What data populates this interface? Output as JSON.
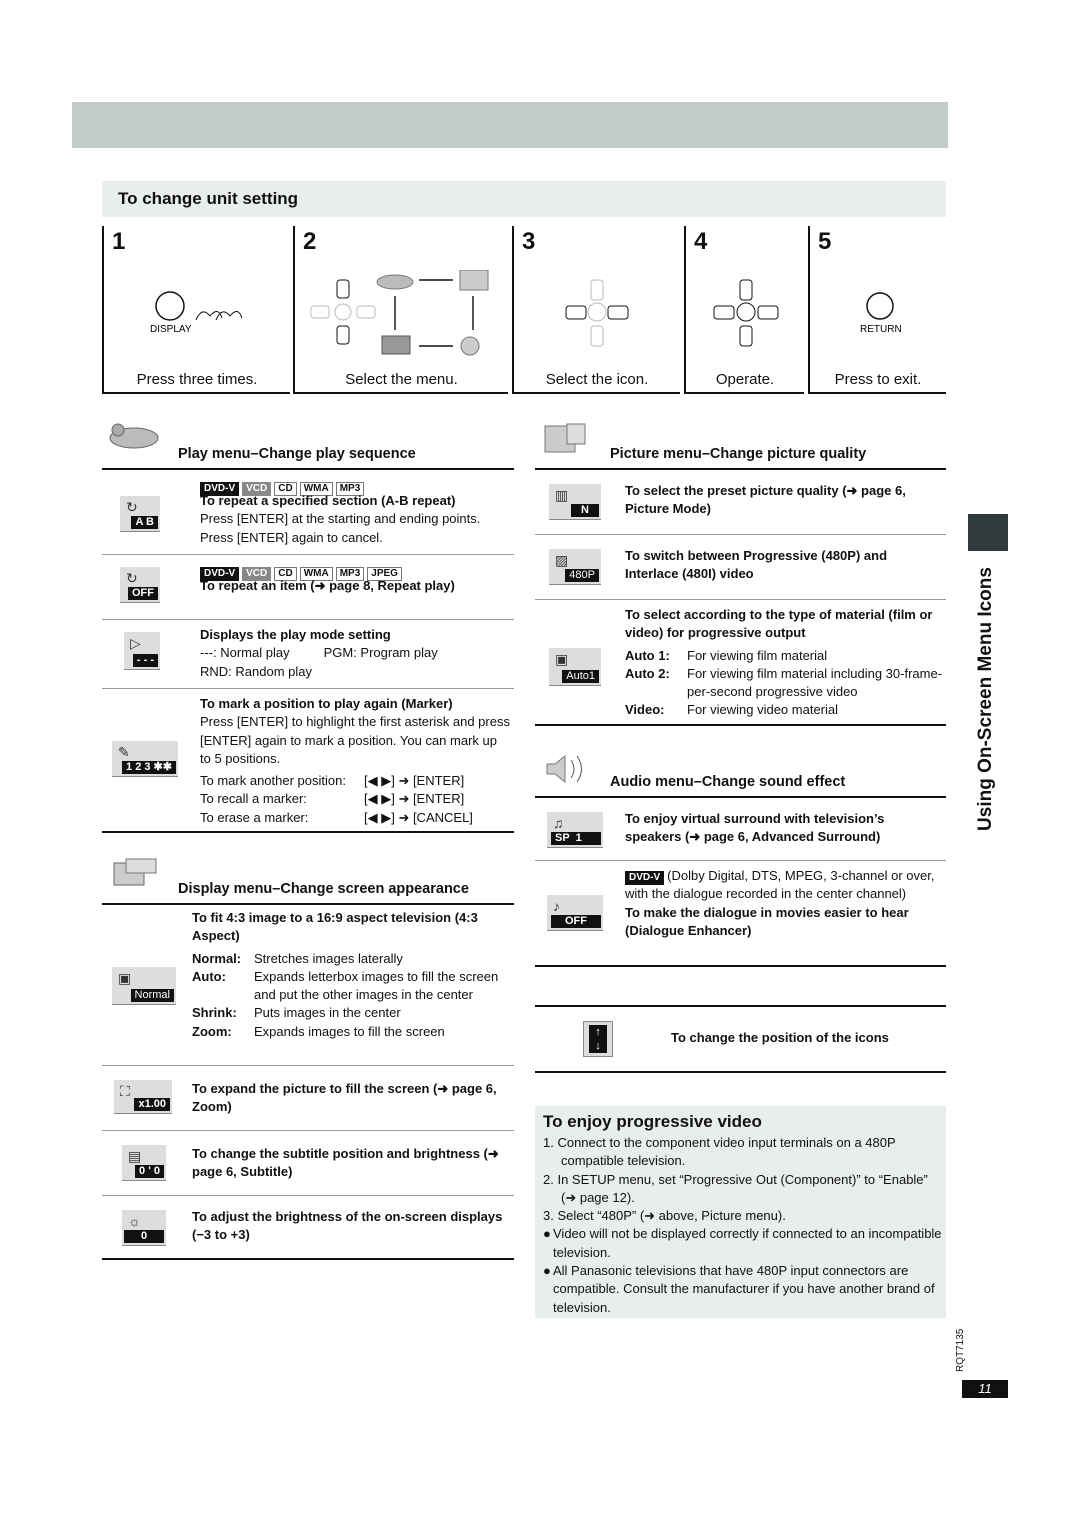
{
  "section_title": "To change unit setting",
  "steps": [
    {
      "num": "1",
      "caption": "Press three times.",
      "button_label": "DISPLAY"
    },
    {
      "num": "2",
      "caption": "Select the menu."
    },
    {
      "num": "3",
      "caption": "Select the icon."
    },
    {
      "num": "4",
      "caption": "Operate."
    },
    {
      "num": "5",
      "caption": "Press to exit.",
      "button_label": "RETURN"
    }
  ],
  "play_menu": {
    "title": "Play menu–Change play sequence",
    "items": [
      {
        "osd": "A B",
        "tags": [
          "DVD-V",
          "VCD",
          "CD",
          "WMA",
          "MP3"
        ],
        "heading": "To repeat a specified section (A-B repeat)",
        "body": "Press [ENTER] at the starting and ending points. Press [ENTER] again to cancel."
      },
      {
        "osd": "OFF",
        "tags": [
          "DVD-V",
          "VCD",
          "CD",
          "WMA",
          "MP3",
          "JPEG"
        ],
        "heading": "To repeat an item (➜ page 8, Repeat play)"
      },
      {
        "osd": "- - -",
        "heading": "Displays the play mode setting",
        "modes": [
          "---: Normal play",
          "PGM: Program play",
          "RND: Random play"
        ]
      },
      {
        "osd": "1 2 3 ✱✱",
        "heading": "To mark a position to play again (Marker)",
        "body": "Press [ENTER] to highlight the first asterisk and press [ENTER] again to mark a position. You can mark up to 5 positions.",
        "actions": [
          {
            "label": "To mark another position:",
            "keys": "[◀ ▶] ➜ [ENTER]"
          },
          {
            "label": "To recall a marker:",
            "keys": "[◀ ▶] ➜ [ENTER]"
          },
          {
            "label": "To erase a marker:",
            "keys": "[◀ ▶] ➜ [CANCEL]"
          }
        ]
      }
    ]
  },
  "display_menu": {
    "title": "Display menu–Change screen appearance",
    "items": [
      {
        "osd": "Normal",
        "heading": "To fit 4:3 image to a 16:9 aspect television (4:3 Aspect)",
        "options": [
          {
            "k": "Normal:",
            "v": "Stretches images laterally"
          },
          {
            "k": "Auto:",
            "v": "Expands letterbox images to fill the screen and put the other images in the center"
          },
          {
            "k": "Shrink:",
            "v": "Puts images in the center"
          },
          {
            "k": "Zoom:",
            "v": "Expands images to fill the screen"
          }
        ]
      },
      {
        "osd": "x1.00",
        "heading": "To expand the picture to fill the screen (➜ page 6, Zoom)"
      },
      {
        "osd": "0 ' 0",
        "heading": "To change the subtitle position and brightness (➜ page 6, Subtitle)"
      },
      {
        "osd": "0",
        "heading": "To adjust the brightness of the on-screen displays (−3 to +3)"
      }
    ]
  },
  "picture_menu": {
    "title": "Picture menu–Change picture quality",
    "items": [
      {
        "osd": "N",
        "heading": "To select the preset picture quality (➜ page 6, Picture Mode)"
      },
      {
        "osd": "480P",
        "heading": "To switch between Progressive (480P) and Interlace (480I) video"
      },
      {
        "osd": "Auto1",
        "heading": "To select according to the type of material (film or video) for progressive output",
        "options": [
          {
            "k": "Auto 1:",
            "v": "For viewing film material"
          },
          {
            "k": "Auto 2:",
            "v": "For viewing film material including 30-frame-per-second progressive video"
          },
          {
            "k": "Video:",
            "v": "For viewing video material"
          }
        ]
      }
    ]
  },
  "audio_menu": {
    "title": "Audio menu–Change sound effect",
    "items": [
      {
        "osd": "SP  1",
        "heading": "To enjoy virtual surround with television’s speakers (➜ page 6, Advanced Surround)"
      },
      {
        "osd": "OFF",
        "tag": "DVD-V",
        "note": "(Dolby Digital, DTS, MPEG, 3-channel or over, with the dialogue recorded in the center channel)",
        "heading": "To make the dialogue in movies easier to hear (Dialogue Enhancer)"
      }
    ]
  },
  "position_item": {
    "heading": "To change the position of the icons"
  },
  "progressive": {
    "title": "To enjoy progressive video",
    "steps": [
      "1.  Connect to the component video input terminals on a 480P compatible television.",
      "2.  In SETUP menu, set “Progressive Out (Component)” to “Enable” (➜ page 12).",
      "3.  Select “480P” (➜ above, Picture menu)."
    ],
    "notes": [
      "Video will not be displayed correctly if connected to an incompatible television.",
      "All Panasonic televisions that have 480P input connectors are compatible. Consult the manufacturer if you have another brand of television."
    ]
  },
  "side_title": "Using On-Screen Menu Icons",
  "doc_code": "RQT7135",
  "page_number": "11"
}
